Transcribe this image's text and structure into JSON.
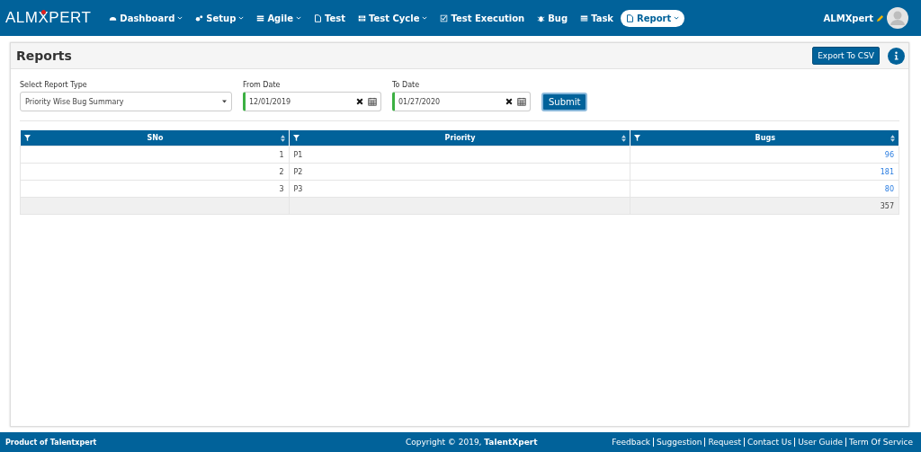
{
  "logo": "ALMXPERT",
  "nav": [
    {
      "label": "Dashboard",
      "kind": "gauge",
      "caret": true,
      "selected": false
    },
    {
      "label": "Setup",
      "kind": "gears",
      "caret": true,
      "selected": false
    },
    {
      "label": "Agile",
      "kind": "list",
      "caret": true,
      "selected": false
    },
    {
      "label": "Test",
      "kind": "doc",
      "caret": false,
      "selected": false
    },
    {
      "label": "Test Cycle",
      "kind": "grid",
      "caret": true,
      "selected": false
    },
    {
      "label": "Test Execution",
      "kind": "check",
      "caret": false,
      "selected": false
    },
    {
      "label": "Bug",
      "kind": "bug",
      "caret": false,
      "selected": false
    },
    {
      "label": "Task",
      "kind": "tasks",
      "caret": false,
      "selected": false
    },
    {
      "label": "Report",
      "kind": "doc",
      "caret": true,
      "selected": true
    }
  ],
  "user": {
    "name": "ALMXpert"
  },
  "panel": {
    "title": "Reports",
    "export_button": "Export To CSV"
  },
  "form": {
    "report_type": {
      "label": "Select Report Type",
      "value": "Priority Wise Bug Summary"
    },
    "from_date": {
      "label": "From Date",
      "value": "12/01/2019"
    },
    "to_date": {
      "label": "To Date",
      "value": "01/27/2020"
    },
    "submit": "Submit"
  },
  "table": {
    "columns": [
      "SNo",
      "Priority",
      "Bugs"
    ],
    "rows": [
      {
        "sno": "1",
        "priority": "P1",
        "bugs": "96"
      },
      {
        "sno": "2",
        "priority": "P2",
        "bugs": "181"
      },
      {
        "sno": "3",
        "priority": "P3",
        "bugs": "80"
      }
    ],
    "total": "357"
  },
  "footer": {
    "left": "Product of Talentxpert",
    "copyright": "Copyright © 2019, **TalentXpert**",
    "links": [
      "Feedback",
      "Suggestion",
      "Request",
      "Contact Us",
      "User Guide",
      "Term Of Service"
    ]
  }
}
